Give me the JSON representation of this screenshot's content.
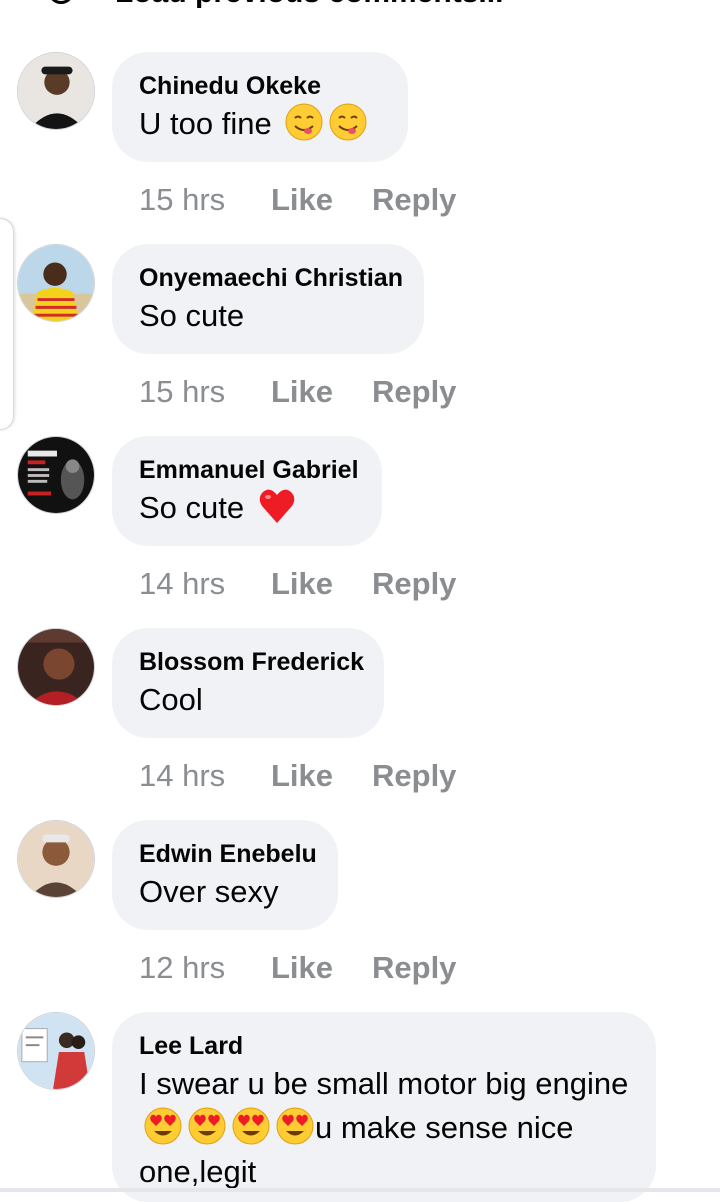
{
  "header": {
    "prev_label": "Load previous comments..."
  },
  "colors": {
    "bubble": "#f0f2f5",
    "meta": "#8a8d91",
    "text": "#050505"
  },
  "comments": [
    {
      "author": "Chinedu Okeke",
      "text": "U too fine",
      "emojis": [
        "yum-face",
        "yum-face"
      ],
      "time": "15 hrs",
      "like": "Like",
      "reply": "Reply"
    },
    {
      "author": "Onyemaechi Christian",
      "text": "So cute",
      "emojis": [],
      "time": "15 hrs",
      "like": "Like",
      "reply": "Reply"
    },
    {
      "author": "Emmanuel Gabriel",
      "text": "So cute",
      "emojis": [
        "red-heart"
      ],
      "time": "14 hrs",
      "like": "Like",
      "reply": "Reply"
    },
    {
      "author": "Blossom Frederick",
      "text": "Cool",
      "emojis": [],
      "time": "14 hrs",
      "like": "Like",
      "reply": "Reply"
    },
    {
      "author": "Edwin Enebelu",
      "text": "Over sexy",
      "emojis": [],
      "time": "12 hrs",
      "like": "Like",
      "reply": "Reply"
    },
    {
      "author": "Lee Lard",
      "text_before": "I swear u be small motor big engine",
      "emojis": [
        "heart-eyes",
        "heart-eyes",
        "heart-eyes",
        "heart-eyes"
      ],
      "text_after": "u make sense nice one,legit"
    }
  ]
}
